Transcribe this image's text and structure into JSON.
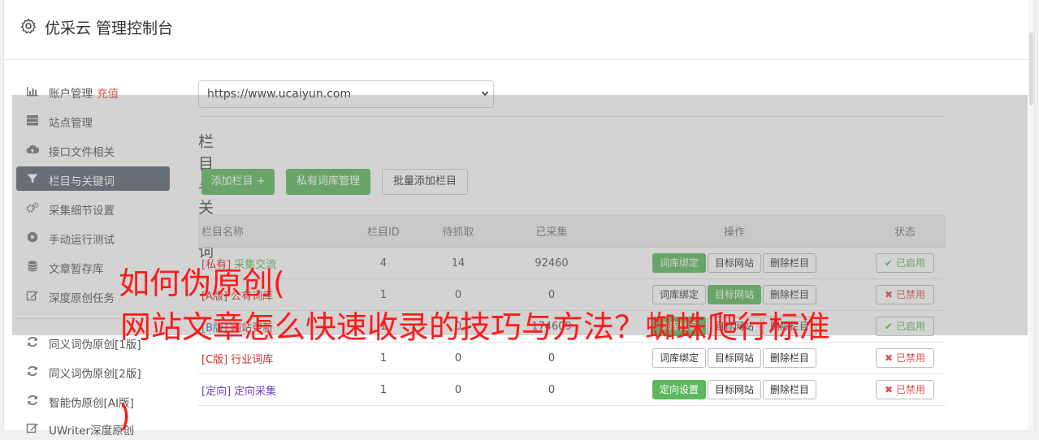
{
  "header": {
    "title": "优采云 管理控制台"
  },
  "sidebar": {
    "items": [
      {
        "icon": "bar-chart-icon",
        "label": "账户管理",
        "extra": "充值"
      },
      {
        "icon": "server-icon",
        "label": "站点管理"
      },
      {
        "icon": "cloud-upload-icon",
        "label": "接口文件相关"
      },
      {
        "icon": "filter-icon",
        "label": "栏目与关键词",
        "active": true
      },
      {
        "icon": "gears-icon",
        "label": "采集细节设置"
      },
      {
        "icon": "play-circle-icon",
        "label": "手动运行测试"
      },
      {
        "icon": "database-icon",
        "label": "文章暂存库"
      },
      {
        "icon": "edit-icon",
        "label": "深度原创任务"
      },
      {
        "icon": "refresh-icon",
        "label": "同义词伪原创[1版]"
      },
      {
        "icon": "refresh-icon",
        "label": "同义词伪原创[2版]"
      },
      {
        "icon": "refresh-icon",
        "label": "智能伪原创[AI版]"
      },
      {
        "icon": "edit-icon",
        "label": "UWriter深度原创"
      }
    ]
  },
  "site_select": {
    "value": "https://www.ucaiyun.com"
  },
  "section": {
    "title": "栏目与关键词"
  },
  "toolbar": {
    "add": "添加栏目 +",
    "private_lib": "私有词库管理",
    "batch_add": "批量添加栏目"
  },
  "table": {
    "headers": {
      "name": "栏目名称",
      "id": "栏目ID",
      "pending": "待抓取",
      "collected": "已采集",
      "ops": "操作",
      "status": "状态"
    },
    "rows": [
      {
        "tag": "[私有]",
        "name": "采集交流",
        "id": "4",
        "pending": "14",
        "collected": "92460",
        "op1": "词库绑定",
        "op2": "目标网站",
        "op3": "删除栏目",
        "status": "已启用"
      },
      {
        "tag": "[A版]",
        "name": "公有词库",
        "id": "1",
        "pending": "0",
        "collected": "0",
        "op1": "词库绑定",
        "op2": "目标网站",
        "op3": "删除栏目",
        "status": "已禁用"
      },
      {
        "tag": "[B版]",
        "name": "网站更新",
        "id": "1",
        "pending": "0",
        "collected": "174609",
        "op1": "词库绑定",
        "op2": "目标网站",
        "op3": "删除栏目",
        "status": "已启用"
      },
      {
        "tag": "[C版]",
        "name": "行业词库",
        "id": "1",
        "pending": "0",
        "collected": "0",
        "op1": "词库绑定",
        "op2": "目标网站",
        "op3": "删除栏目",
        "status": "已禁用"
      },
      {
        "tag": "[定向]",
        "name": "定向采集",
        "id": "1",
        "pending": "0",
        "collected": "0",
        "op1": "定向设置",
        "op2": "目标网站",
        "op3": "删除栏目",
        "status": "已禁用"
      }
    ]
  },
  "overlay": {
    "line1": "如何伪原创(",
    "line2": "网站文章怎么快速收录的技巧与方法？蜘蛛爬行标准",
    "line3": ")"
  }
}
